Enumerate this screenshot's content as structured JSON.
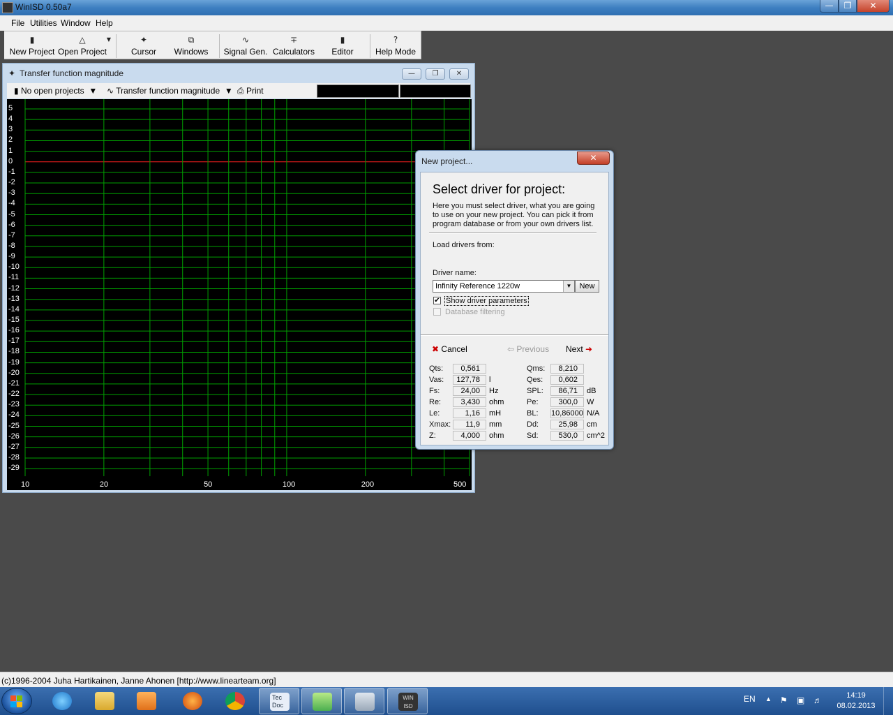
{
  "window": {
    "title": "WinISD 0.50a7"
  },
  "menu": [
    "File",
    "Utilities",
    "Window",
    "Help"
  ],
  "toolbar": {
    "new_project": "New Project",
    "open_project": "Open Project",
    "cursor": "Cursor",
    "windows": "Windows",
    "signal_gen": "Signal Gen.",
    "calculators": "Calculators",
    "editor": "Editor",
    "help_mode": "Help Mode"
  },
  "graph_window": {
    "title": "Transfer function magnitude",
    "projects_dropdown": "No open projects",
    "graph_dropdown": "Transfer function magnitude",
    "print": "Print",
    "y_labels": [
      "5",
      "4",
      "3",
      "2",
      "1",
      "0",
      "-1",
      "-2",
      "-3",
      "-4",
      "-5",
      "-6",
      "-7",
      "-8",
      "-9",
      "-10",
      "-11",
      "-12",
      "-13",
      "-14",
      "-15",
      "-16",
      "-17",
      "-18",
      "-19",
      "-20",
      "-21",
      "-22",
      "-23",
      "-24",
      "-25",
      "-26",
      "-27",
      "-28",
      "-29"
    ],
    "x_labels": [
      "10",
      "20",
      "50",
      "100",
      "200",
      "500"
    ],
    "grid_color": "#00a000",
    "zero_line_color": "#ff2020"
  },
  "dialog": {
    "title": "New project...",
    "heading": "Select driver for project:",
    "description": "Here you must select driver, what you are going to use on your new project. You can pick it from program database or from your own drivers list.",
    "load_from_label": "Load drivers from:",
    "driver_name_label": "Driver name:",
    "driver_name_value": "Infinity Reference 1220w",
    "new_button": "New",
    "show_params_label": "Show driver parameters",
    "show_params_checked": true,
    "db_filtering_label": "Database filtering",
    "db_filtering_checked": false,
    "cancel": "Cancel",
    "previous": "Previous",
    "next": "Next",
    "params_left": [
      {
        "name": "Qts:",
        "value": "0,561",
        "unit": ""
      },
      {
        "name": "Vas:",
        "value": "127,78",
        "unit": "l"
      },
      {
        "name": "Fs:",
        "value": "24,00",
        "unit": "Hz"
      },
      {
        "name": "Re:",
        "value": "3,430",
        "unit": "ohm"
      },
      {
        "name": "Le:",
        "value": "1,16",
        "unit": "mH"
      },
      {
        "name": "Xmax:",
        "value": "11,9",
        "unit": "mm"
      },
      {
        "name": "Z:",
        "value": "4,000",
        "unit": "ohm"
      }
    ],
    "params_right": [
      {
        "name": "Qms:",
        "value": "8,210",
        "unit": ""
      },
      {
        "name": "Qes:",
        "value": "0,602",
        "unit": ""
      },
      {
        "name": "SPL:",
        "value": "86,71",
        "unit": "dB"
      },
      {
        "name": "Pe:",
        "value": "300,0",
        "unit": "W"
      },
      {
        "name": "BL:",
        "value": "10,86000",
        "unit": "N/A"
      },
      {
        "name": "Dd:",
        "value": "25,98",
        "unit": "cm"
      },
      {
        "name": "Sd:",
        "value": "530,0",
        "unit": "cm^2"
      }
    ]
  },
  "status": {
    "text": "(c)1996-2004 Juha Hartikainen, Janne Ahonen [http://www.linearteam.org]"
  },
  "taskbar": {
    "language": "EN",
    "time": "14:19",
    "date": "08.02.2013",
    "tecdoc_label": "Tec Doc",
    "winisd_label": "WIN ISD"
  }
}
